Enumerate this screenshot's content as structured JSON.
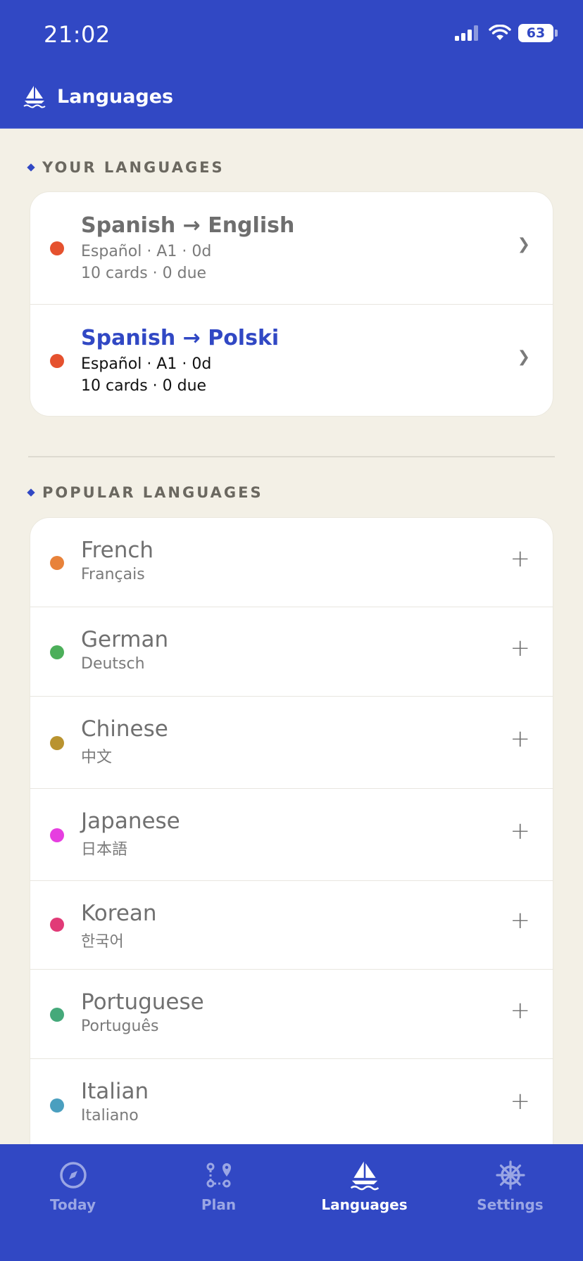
{
  "status_bar": {
    "time": "21:02",
    "battery": "63"
  },
  "header": {
    "title": "Languages"
  },
  "your_languages": {
    "label": "YOUR LANGUAGES",
    "items": [
      {
        "title": "Spanish → English",
        "meta": "Español · A1 · 0d",
        "stats": "10 cards · 0 due",
        "active": false,
        "color": "#e5512e"
      },
      {
        "title": "Spanish → Polski",
        "meta": "Español · A1 · 0d",
        "stats": "10 cards · 0 due",
        "active": true,
        "color": "#e5512e"
      }
    ]
  },
  "popular_languages": {
    "label": "POPULAR LANGUAGES",
    "items": [
      {
        "name": "French",
        "native": "Français",
        "color": "#e8823a"
      },
      {
        "name": "German",
        "native": "Deutsch",
        "color": "#4caf5a"
      },
      {
        "name": "Chinese",
        "native": "中文",
        "color": "#b9932f"
      },
      {
        "name": "Japanese",
        "native": "日本語",
        "color": "#e63ee0"
      },
      {
        "name": "Korean",
        "native": "한국어",
        "color": "#e13a77"
      },
      {
        "name": "Portuguese",
        "native": "Português",
        "color": "#45a97a"
      },
      {
        "name": "Italian",
        "native": "Italiano",
        "color": "#4a9fbf"
      }
    ]
  },
  "tabs": [
    {
      "label": "Today",
      "icon": "compass-icon",
      "active": false
    },
    {
      "label": "Plan",
      "icon": "route-icon",
      "active": false
    },
    {
      "label": "Languages",
      "icon": "sailboat-icon",
      "active": true
    },
    {
      "label": "Settings",
      "icon": "helm-icon",
      "active": false
    }
  ],
  "colors": {
    "brand": "#3148c4",
    "background": "#f3f0e6"
  }
}
